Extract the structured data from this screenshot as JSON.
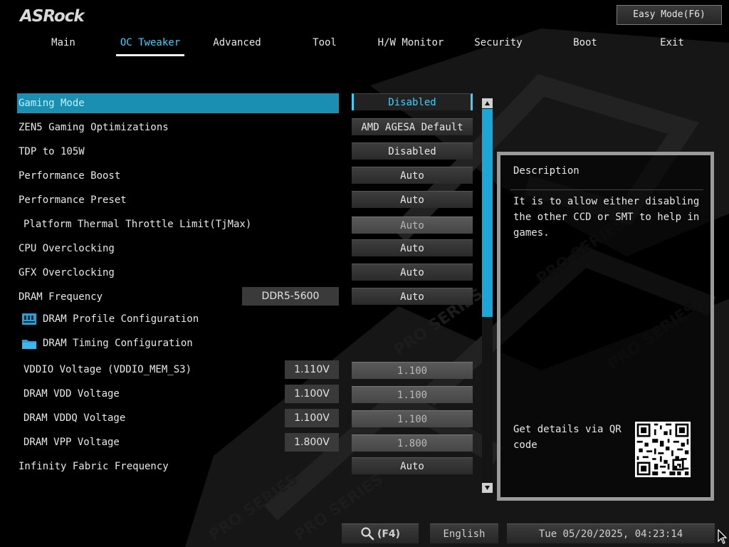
{
  "brand": {
    "logo": "ASRock"
  },
  "header": {
    "easy_mode": "Easy Mode(F6)"
  },
  "tabs": [
    {
      "label": "Main",
      "active": false
    },
    {
      "label": "OC Tweaker",
      "active": true
    },
    {
      "label": "Advanced",
      "active": false
    },
    {
      "label": "Tool",
      "active": false
    },
    {
      "label": "H/W Monitor",
      "active": false
    },
    {
      "label": "Security",
      "active": false
    },
    {
      "label": "Boot",
      "active": false
    },
    {
      "label": "Exit",
      "active": false
    }
  ],
  "settings": [
    {
      "label": "Gaming Mode",
      "value": "Disabled",
      "selected": true
    },
    {
      "label": "ZEN5 Gaming Optimizations",
      "value": "AMD AGESA Default"
    },
    {
      "label": "TDP to 105W",
      "value": "Disabled"
    },
    {
      "label": "Performance Boost",
      "value": "Auto"
    },
    {
      "label": "Performance Preset",
      "value": "Auto"
    },
    {
      "label": "Platform Thermal Throttle Limit(TjMax)",
      "value": "Auto",
      "dim": true
    },
    {
      "label": "CPU Overclocking",
      "value": "Auto"
    },
    {
      "label": "GFX Overclocking",
      "value": "Auto"
    },
    {
      "label": "DRAM Frequency",
      "value": "Auto",
      "info": "DDR5-5600"
    },
    {
      "label": "DRAM Profile Configuration",
      "icon": "dram-profile-icon"
    },
    {
      "label": "DRAM Timing Configuration",
      "icon": "folder-icon"
    },
    {
      "label": "VDDIO Voltage (VDDIO_MEM_S3)",
      "value": "1.100",
      "info": "1.110V",
      "dim": true
    },
    {
      "label": "DRAM VDD Voltage",
      "value": "1.100",
      "info": "1.100V",
      "dim": true
    },
    {
      "label": "DRAM VDDQ Voltage",
      "value": "1.100",
      "info": "1.100V",
      "dim": true
    },
    {
      "label": "DRAM VPP Voltage",
      "value": "1.800",
      "info": "1.800V",
      "dim": true
    },
    {
      "label": "Infinity Fabric Frequency",
      "value": "Auto"
    }
  ],
  "scrollbar": {
    "position_fraction": 0.0,
    "visible_fraction": 0.56
  },
  "description": {
    "title": "Description",
    "text": "It is to allow either disabling the other CCD or SMT to help in games.",
    "qr_label": "Get details via QR code"
  },
  "bottom": {
    "search": "(F4)",
    "language": "English",
    "datetime": "Tue 05/20/2025, 04:23:14"
  },
  "colors": {
    "accent": "#3cd0ff",
    "selection": "#1a8fb2",
    "scroll_thumb": "#1aa6d8"
  },
  "icons": [
    "search-icon",
    "dram-profile-icon",
    "folder-icon",
    "qr-code",
    "mouse-cursor-icon"
  ]
}
